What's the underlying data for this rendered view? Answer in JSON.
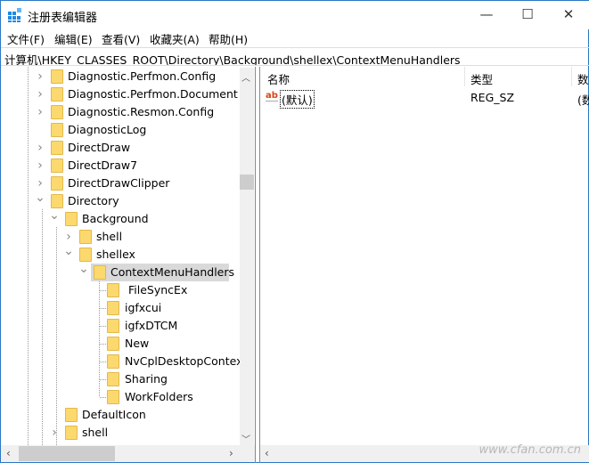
{
  "window": {
    "title": "注册表编辑器",
    "minimize": "—",
    "maximize": "☐",
    "close": "✕",
    "icon": "registry-editor-icon"
  },
  "menu": [
    "文件(F)",
    "编辑(E)",
    "查看(V)",
    "收藏夹(A)",
    "帮助(H)"
  ],
  "address": "计算机\\HKEY_CLASSES_ROOT\\Directory\\Background\\shellex\\ContextMenuHandlers",
  "tree": [
    {
      "label": "Diagnostic.Perfmon.Config",
      "level": 0,
      "expander": "collapsed"
    },
    {
      "label": "Diagnostic.Perfmon.Document",
      "level": 0,
      "expander": "collapsed"
    },
    {
      "label": "Diagnostic.Resmon.Config",
      "level": 0,
      "expander": "collapsed"
    },
    {
      "label": "DiagnosticLog",
      "level": 0,
      "expander": "none"
    },
    {
      "label": "DirectDraw",
      "level": 0,
      "expander": "collapsed"
    },
    {
      "label": "DirectDraw7",
      "level": 0,
      "expander": "collapsed"
    },
    {
      "label": "DirectDrawClipper",
      "level": 0,
      "expander": "collapsed"
    },
    {
      "label": "Directory",
      "level": 0,
      "expander": "expanded"
    },
    {
      "label": "Background",
      "level": 1,
      "expander": "expanded"
    },
    {
      "label": "shell",
      "level": 2,
      "expander": "collapsed"
    },
    {
      "label": "shellex",
      "level": 2,
      "expander": "expanded"
    },
    {
      "label": "ContextMenuHandlers",
      "level": 3,
      "expander": "expanded",
      "selected": true
    },
    {
      "label": "FileSyncEx",
      "level": 4,
      "expander": "none"
    },
    {
      "label": "igfxcui",
      "level": 4,
      "expander": "none"
    },
    {
      "label": "igfxDTCM",
      "level": 4,
      "expander": "none"
    },
    {
      "label": "New",
      "level": 4,
      "expander": "none"
    },
    {
      "label": "NvCplDesktopContext",
      "level": 4,
      "expander": "none"
    },
    {
      "label": "Sharing",
      "level": 4,
      "expander": "none"
    },
    {
      "label": "WorkFolders",
      "level": 4,
      "expander": "none"
    },
    {
      "label": "DefaultIcon",
      "level": 1,
      "expander": "none"
    },
    {
      "label": "shell",
      "level": 1,
      "expander": "collapsed"
    }
  ],
  "columns": [
    "名称",
    "类型",
    "数"
  ],
  "values": [
    {
      "name": "(默认)",
      "type": "REG_SZ",
      "data": "(数",
      "icon": "string-value-icon"
    }
  ],
  "watermark": "www.cfan.com.cn"
}
